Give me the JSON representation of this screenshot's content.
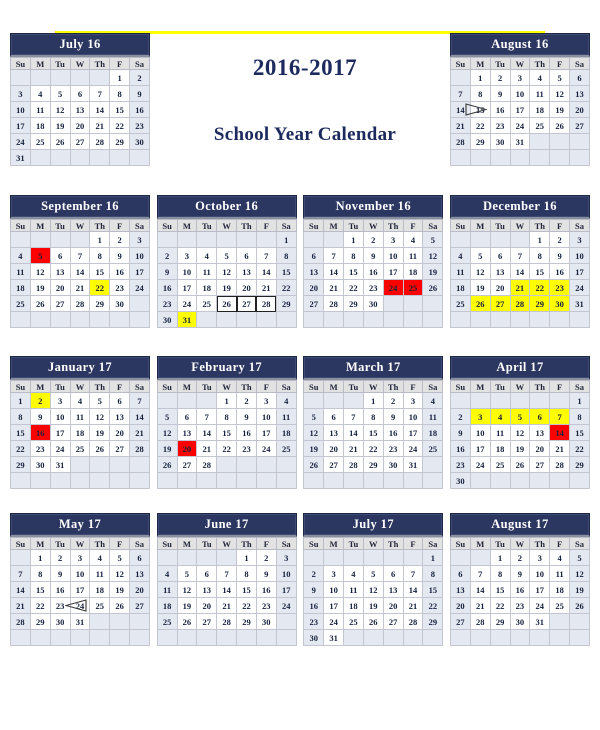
{
  "page": {
    "title_year": "2016-2017",
    "title_main": "School Year Calendar",
    "accent_navy": "#2b3760",
    "accent_yellow": "#ffff00",
    "accent_red": "#fe0000",
    "title_color": "#1c2a5e",
    "top_rule_color": "#ffff00"
  },
  "weekdays": [
    "Su",
    "M",
    "Tu",
    "W",
    "Th",
    "F",
    "Sa"
  ],
  "months": [
    {
      "id": "july-16",
      "label": "July 16",
      "first_weekday": 5,
      "days": 31,
      "highlight_yellow": [],
      "highlight_red": [],
      "boxed": [],
      "marker_triangle": []
    },
    {
      "id": "august-16",
      "label": "August 16",
      "first_weekday": 1,
      "days": 31,
      "highlight_yellow": [],
      "highlight_red": [],
      "boxed": [],
      "marker_triangle": [
        15
      ]
    },
    {
      "id": "september-16",
      "label": "September 16",
      "first_weekday": 4,
      "days": 30,
      "highlight_yellow": [
        22
      ],
      "highlight_red": [
        5
      ],
      "boxed": [],
      "marker_triangle": []
    },
    {
      "id": "october-16",
      "label": "October 16",
      "first_weekday": 6,
      "days": 31,
      "highlight_yellow": [
        31
      ],
      "highlight_red": [],
      "boxed": [
        26,
        27,
        28
      ],
      "marker_triangle": []
    },
    {
      "id": "november-16",
      "label": "November 16",
      "first_weekday": 2,
      "days": 30,
      "highlight_yellow": [],
      "highlight_red": [
        24,
        25
      ],
      "boxed": [],
      "marker_triangle": []
    },
    {
      "id": "december-16",
      "label": "December 16",
      "first_weekday": 4,
      "days": 31,
      "highlight_yellow": [
        21,
        22,
        23,
        26,
        27,
        28,
        29,
        30
      ],
      "highlight_red": [],
      "boxed": [],
      "marker_triangle": []
    },
    {
      "id": "january-17",
      "label": "January 17",
      "first_weekday": 0,
      "days": 31,
      "highlight_yellow": [
        2
      ],
      "highlight_red": [
        16
      ],
      "boxed": [],
      "marker_triangle": []
    },
    {
      "id": "february-17",
      "label": "February 17",
      "first_weekday": 3,
      "days": 28,
      "highlight_yellow": [],
      "highlight_red": [
        20
      ],
      "boxed": [],
      "marker_triangle": []
    },
    {
      "id": "march-17",
      "label": "March 17",
      "first_weekday": 3,
      "days": 31,
      "highlight_yellow": [],
      "highlight_red": [],
      "boxed": [],
      "marker_triangle": []
    },
    {
      "id": "april-17",
      "label": "April 17",
      "first_weekday": 6,
      "days": 30,
      "highlight_yellow": [
        3,
        4,
        5,
        6,
        7
      ],
      "highlight_red": [
        14
      ],
      "boxed": [],
      "marker_triangle": []
    },
    {
      "id": "may-17",
      "label": "May 17",
      "first_weekday": 1,
      "days": 31,
      "highlight_yellow": [],
      "highlight_red": [],
      "boxed": [],
      "marker_triangle": [
        24
      ]
    },
    {
      "id": "june-17",
      "label": "June 17",
      "first_weekday": 4,
      "days": 30,
      "highlight_yellow": [],
      "highlight_red": [],
      "boxed": [],
      "marker_triangle": []
    },
    {
      "id": "july-17",
      "label": "July 17",
      "first_weekday": 6,
      "days": 31,
      "highlight_yellow": [],
      "highlight_red": [],
      "boxed": [],
      "marker_triangle": []
    },
    {
      "id": "august-17",
      "label": "August 17",
      "first_weekday": 2,
      "days": 31,
      "highlight_yellow": [],
      "highlight_red": [],
      "boxed": [],
      "marker_triangle": []
    }
  ],
  "layout_rows": [
    {
      "slots": [
        "july-16",
        null,
        null,
        "august-16"
      ]
    },
    {
      "slots": [
        "september-16",
        "october-16",
        "november-16",
        "december-16"
      ]
    },
    {
      "slots": [
        "january-17",
        "february-17",
        "march-17",
        "april-17"
      ]
    },
    {
      "slots": [
        "may-17",
        "june-17",
        "july-17",
        "august-17"
      ]
    }
  ]
}
